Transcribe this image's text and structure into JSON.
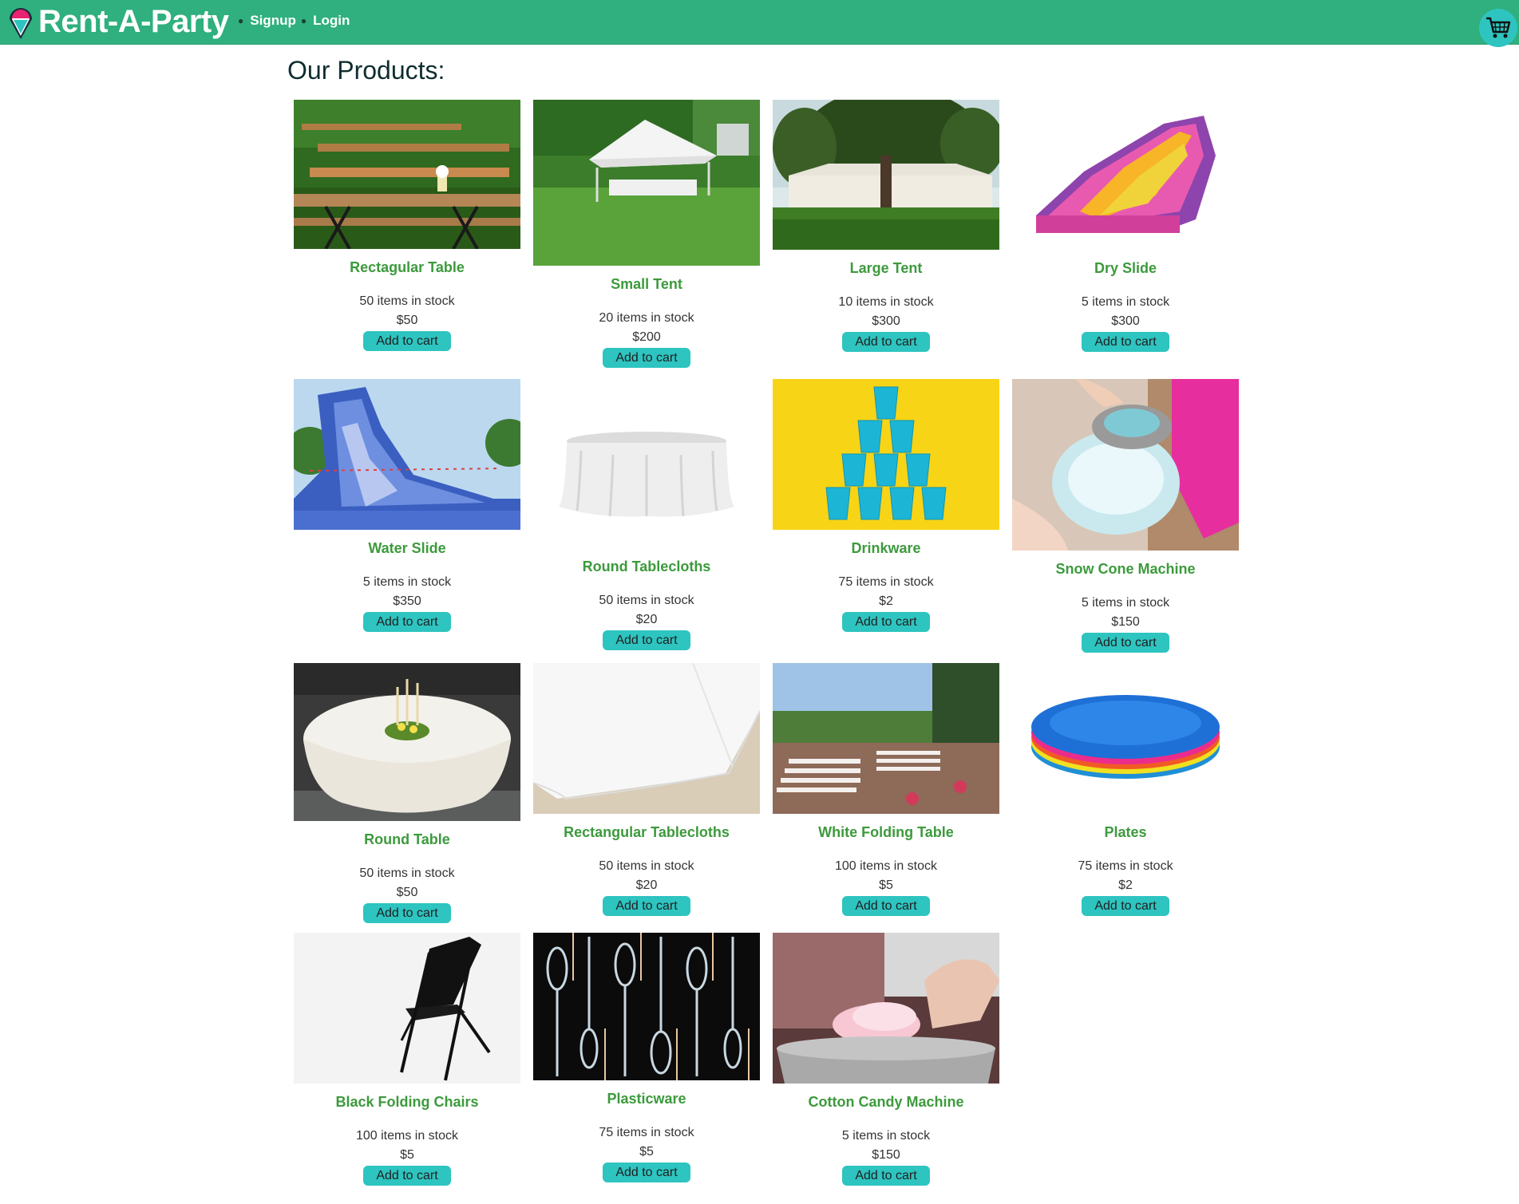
{
  "nav": {
    "brand": "Rent-A-Party",
    "links": [
      "Signup",
      "Login"
    ],
    "cart_icon": "shopping-cart-icon"
  },
  "page": {
    "title": "Our Products:"
  },
  "colors": {
    "navbar": "#2fb07e",
    "button": "#2ec4c0",
    "product_name": "#3c9a3c"
  },
  "products": [
    {
      "name": "Rectagular Table",
      "stock": "50 items in stock",
      "price": "$50",
      "button": "Add to cart"
    },
    {
      "name": "Small Tent",
      "stock": "20 items in stock",
      "price": "$200",
      "button": "Add to cart"
    },
    {
      "name": "Large Tent",
      "stock": "10 items in stock",
      "price": "$300",
      "button": "Add to cart"
    },
    {
      "name": "Dry Slide",
      "stock": "5 items in stock",
      "price": "$300",
      "button": "Add to cart"
    },
    {
      "name": "Water Slide",
      "stock": "5 items in stock",
      "price": "$350",
      "button": "Add to cart"
    },
    {
      "name": "Round Tablecloths",
      "stock": "50 items in stock",
      "price": "$20",
      "button": "Add to cart"
    },
    {
      "name": "Drinkware",
      "stock": "75 items in stock",
      "price": "$2",
      "button": "Add to cart"
    },
    {
      "name": "Snow Cone Machine",
      "stock": "5 items in stock",
      "price": "$150",
      "button": "Add to cart"
    },
    {
      "name": "Round Table",
      "stock": "50 items in stock",
      "price": "$50",
      "button": "Add to cart"
    },
    {
      "name": "Rectangular Tablecloths",
      "stock": "50 items in stock",
      "price": "$20",
      "button": "Add to cart"
    },
    {
      "name": "White Folding Table",
      "stock": "100 items in stock",
      "price": "$5",
      "button": "Add to cart"
    },
    {
      "name": "Plates",
      "stock": "75 items in stock",
      "price": "$2",
      "button": "Add to cart"
    },
    {
      "name": "Black Folding Chairs",
      "stock": "100 items in stock",
      "price": "$5",
      "button": "Add to cart"
    },
    {
      "name": "Plasticware",
      "stock": "75 items in stock",
      "price": "$5",
      "button": "Add to cart"
    },
    {
      "name": "Cotton Candy Machine",
      "stock": "5 items in stock",
      "price": "$150",
      "button": "Add to cart"
    }
  ]
}
